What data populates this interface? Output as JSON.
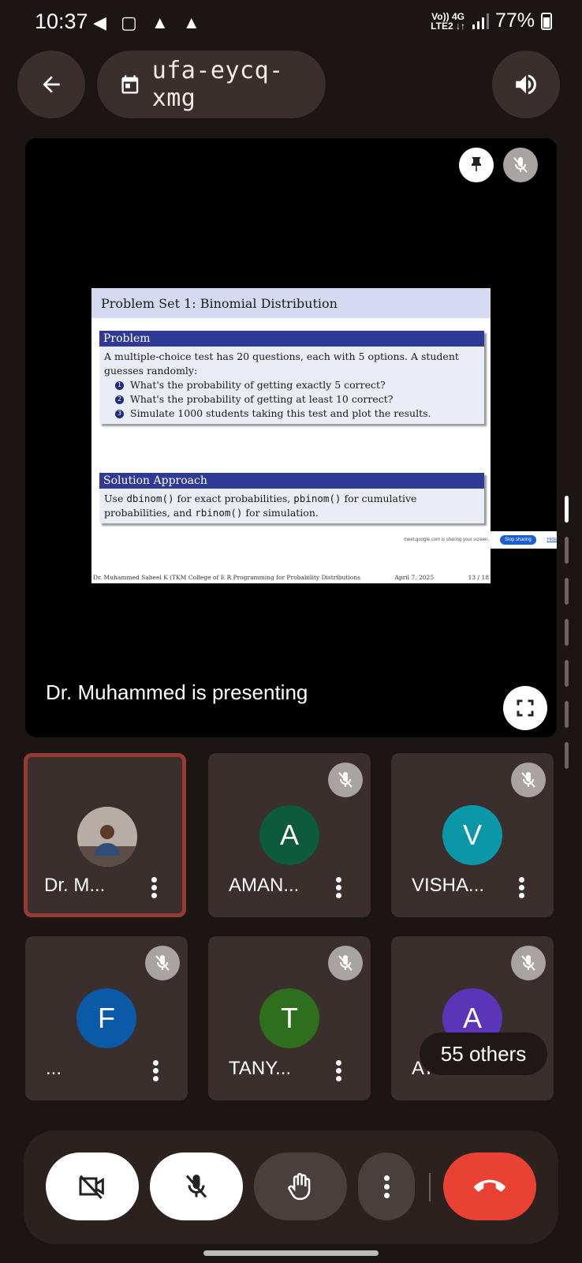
{
  "status_bar": {
    "time": "10:37",
    "left_icons": "◀ ▢ ▲ ▲",
    "network": "Vo)) 4G\nLTE2 ↓↑",
    "battery": "77%"
  },
  "header": {
    "back_icon": "arrow-left-icon",
    "meeting_code": "ufa-eycq-xmg",
    "audio_icon": "speaker-icon"
  },
  "presentation": {
    "slide": {
      "title": "Problem Set 1: Binomial Distribution",
      "problem_heading": "Problem",
      "problem_text": "A multiple-choice test has 20 questions, each with 5 options. A student guesses randomly:",
      "items": [
        {
          "n": "1",
          "text": "What's the probability of getting exactly 5 correct?"
        },
        {
          "n": "2",
          "text": "What's the probability of getting at least 10 correct?"
        },
        {
          "n": "3",
          "text": "Simulate 1000 students taking this test and plot the results."
        }
      ],
      "solution_heading": "Solution Approach",
      "solution_text_1": "Use ",
      "fn_dbinom": "dbinom()",
      "solution_text_2": " for exact probabilities, ",
      "fn_pbinom": "pbinom()",
      "solution_text_3": " for cumulative probabilities, and ",
      "fn_rbinom": "rbinom()",
      "solution_text_4": " for simulation.",
      "footer_left": "Dr. Muhammed Sabeel K (TKM College of E R Programming for Probability Distributions",
      "footer_date": "April 7, 2025",
      "footer_page": "13 / 18"
    },
    "share_banner": {
      "text": "meet.google.com is sharing your screen.",
      "stop_label": "Stop sharing",
      "hide_label": "Hide"
    },
    "presenting_label": "Dr. Muhammed is presenting"
  },
  "participants": [
    {
      "name": "Dr. M...",
      "initial": "",
      "color": "#3b5f7a",
      "muted": false,
      "active": true
    },
    {
      "name": "AMAN...",
      "initial": "A",
      "color": "#0e5a3c",
      "muted": true,
      "active": false
    },
    {
      "name": "VISHA...",
      "initial": "V",
      "color": "#0a97a7",
      "muted": true,
      "active": false
    },
    {
      "name": "...",
      "initial": "F",
      "color": "#0b5aa8",
      "muted": true,
      "active": false
    },
    {
      "name": "TANY...",
      "initial": "T",
      "color": "#2e6f1e",
      "muted": true,
      "active": false
    },
    {
      "name": "AT",
      "initial": "A",
      "color": "#5a35b8",
      "muted": true,
      "active": false
    }
  ],
  "others_label": "55 others",
  "controls": {
    "camera": "camera-off-icon",
    "mic": "mic-off-icon",
    "hand": "raise-hand-icon",
    "more": "more-vert-icon",
    "end_call": "end-call-icon",
    "end_color": "#e94235"
  }
}
